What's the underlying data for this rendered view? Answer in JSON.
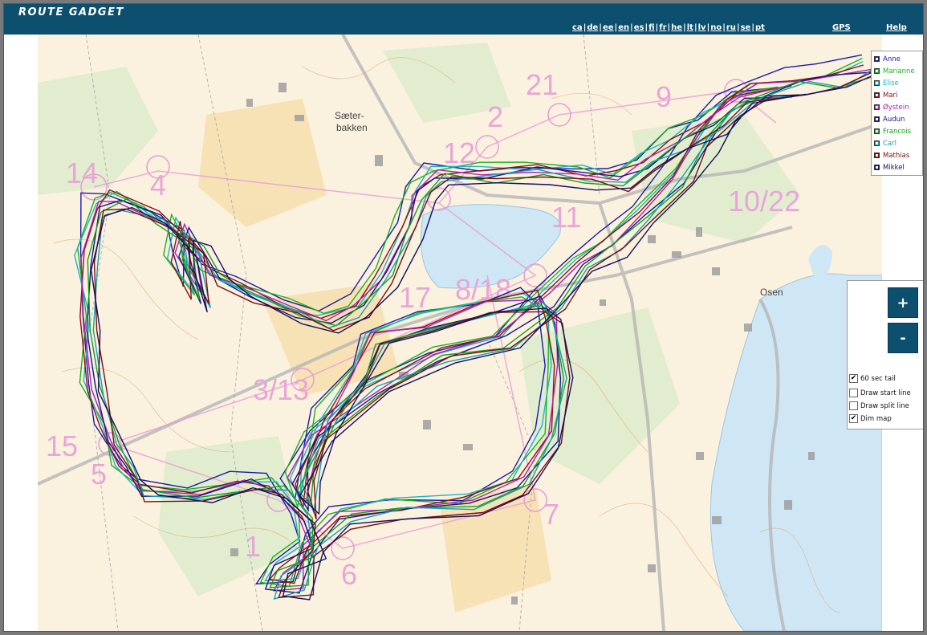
{
  "app": {
    "logo_text": "ROUTE GADGET"
  },
  "header": {
    "languages": [
      "ca",
      "de",
      "ee",
      "en",
      "es",
      "fi",
      "fr",
      "he",
      "lt",
      "lv",
      "no",
      "ru",
      "se",
      "pt"
    ],
    "gps_label": "GPS",
    "help_label": "Help"
  },
  "map": {
    "control_labels": [
      "21",
      "2",
      "12",
      "14",
      "4",
      "11",
      "10/22",
      "17",
      "8/18",
      "3/13",
      "15",
      "5",
      "7",
      "6",
      "1",
      "9"
    ],
    "place_labels": [
      "Sæter-",
      "bakken",
      "Osen"
    ]
  },
  "runners": [
    {
      "name": "Anne",
      "color": "#1a1aa8"
    },
    {
      "name": "Marianne",
      "color": "#19b319"
    },
    {
      "name": "Elise",
      "color": "#1ab3c4"
    },
    {
      "name": "Mari",
      "color": "#8c1010"
    },
    {
      "name": "Øystein",
      "color": "#b01eb0"
    },
    {
      "name": "Audun",
      "color": "#14148c"
    },
    {
      "name": "Francois",
      "color": "#16a016"
    },
    {
      "name": "Carl",
      "color": "#16a0b0"
    },
    {
      "name": "Mathias",
      "color": "#7a0d0d"
    },
    {
      "name": "Mikkel",
      "color": "#101060"
    }
  ],
  "controls": {
    "zoom_in_label": "+",
    "zoom_out_label": "-",
    "options": [
      {
        "label": "60 sec tail",
        "checked": true
      },
      {
        "label": "Draw start line",
        "checked": false
      },
      {
        "label": "Draw split line",
        "checked": false
      },
      {
        "label": "Dim map",
        "checked": true
      }
    ]
  },
  "colors": {
    "header_bg": "#0c4f6e",
    "lake": "#cfe6f5",
    "map_bg": "#fbf1df",
    "course": "#e89ad6"
  }
}
